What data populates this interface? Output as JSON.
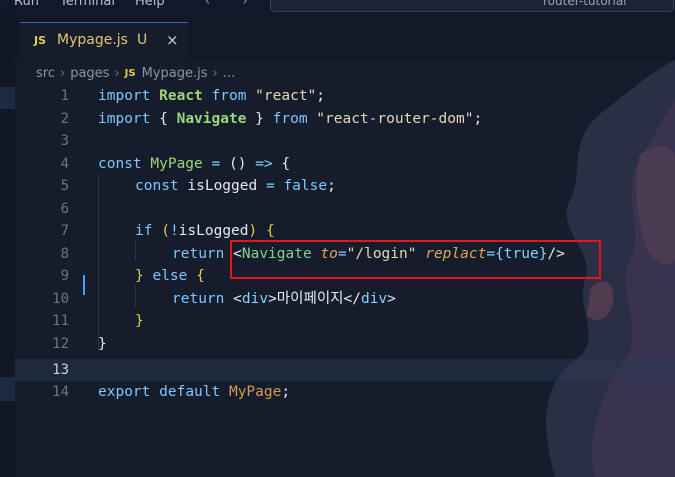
{
  "menubar": {
    "items": [
      "Run",
      "Terminal",
      "Help"
    ],
    "nav": "‹ ›",
    "command_center_text": "router-tutorial"
  },
  "tab": {
    "badge": "JS",
    "name": "Mypage.js",
    "status": "U",
    "close": "×"
  },
  "breadcrumb": {
    "parts": [
      "src",
      "pages",
      "Mypage.js",
      "..."
    ],
    "js_badge": "JS",
    "separator": "›"
  },
  "editor": {
    "current_line": 13,
    "lines": [
      {
        "n": "1"
      },
      {
        "n": "2"
      },
      {
        "n": "3"
      },
      {
        "n": "4"
      },
      {
        "n": "5"
      },
      {
        "n": "6"
      },
      {
        "n": "7"
      },
      {
        "n": "8"
      },
      {
        "n": "9"
      },
      {
        "n": "10"
      },
      {
        "n": "11"
      },
      {
        "n": "12"
      },
      {
        "n": "13"
      },
      {
        "n": "14"
      }
    ],
    "tokens": {
      "l1": [
        "import",
        "React",
        "from",
        "\"react\"",
        ";"
      ],
      "l2": [
        "import",
        "{",
        "Navigate",
        "}",
        "from",
        "\"react-router-dom\"",
        ";"
      ],
      "l4": [
        "const",
        "MyPage",
        "=",
        "()",
        "=>",
        "{"
      ],
      "l5": [
        "const",
        "isLogged",
        "=",
        "false",
        ";"
      ],
      "l7": [
        "if",
        "(",
        "!",
        "isLogged",
        ")",
        "{"
      ],
      "l8": [
        "return",
        "<",
        "Navigate",
        "to",
        "=",
        "\"/login\"",
        "replact",
        "=",
        "{",
        "true",
        "}",
        "/>"
      ],
      "l9": [
        "}",
        "else",
        "{"
      ],
      "l10": [
        "return",
        "<",
        "div",
        ">",
        "마이페이지",
        "</",
        "div",
        ">"
      ],
      "l11": [
        "}"
      ],
      "l12": [
        "}"
      ],
      "l14": [
        "export",
        "default",
        "MyPage",
        ";"
      ]
    }
  },
  "colors": {
    "background": "#151c2c",
    "highlight_box": "#e8141b",
    "cursor": "#4a9df8",
    "keyword": "#7ec6ff",
    "string": "#e9d6b2",
    "component": "#d59b4c"
  }
}
